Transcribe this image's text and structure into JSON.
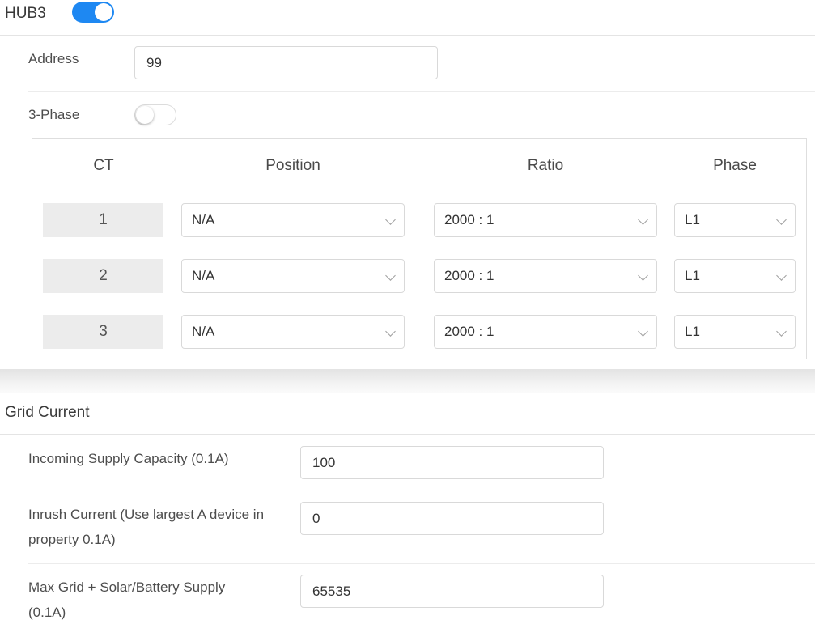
{
  "hub": {
    "title": "HUB3",
    "enabled": true,
    "address_label": "Address",
    "address_value": "99",
    "three_phase_label": "3-Phase",
    "three_phase_enabled": false,
    "table": {
      "headers": [
        "CT",
        "Position",
        "Ratio",
        "Phase"
      ],
      "rows": [
        {
          "ct": "1",
          "position": "N/A",
          "ratio": "2000 : 1",
          "phase": "L1"
        },
        {
          "ct": "2",
          "position": "N/A",
          "ratio": "2000 : 1",
          "phase": "L1"
        },
        {
          "ct": "3",
          "position": "N/A",
          "ratio": "2000 : 1",
          "phase": "L1"
        }
      ]
    }
  },
  "grid_current": {
    "title": "Grid Current",
    "fields": [
      {
        "label_lines": [
          "Incoming Supply Capacity (0.1A)"
        ],
        "value": "100"
      },
      {
        "label_lines": [
          "Inrush Current (Use largest A device in",
          "property 0.1A)"
        ],
        "value": "0"
      },
      {
        "label_lines": [
          "Max Grid + Solar/Battery Supply",
          "(0.1A)"
        ],
        "value": "65535"
      }
    ]
  },
  "colors": {
    "accent": "#1e88f2"
  },
  "icons": {
    "dropdown": "chevron-down-icon"
  }
}
